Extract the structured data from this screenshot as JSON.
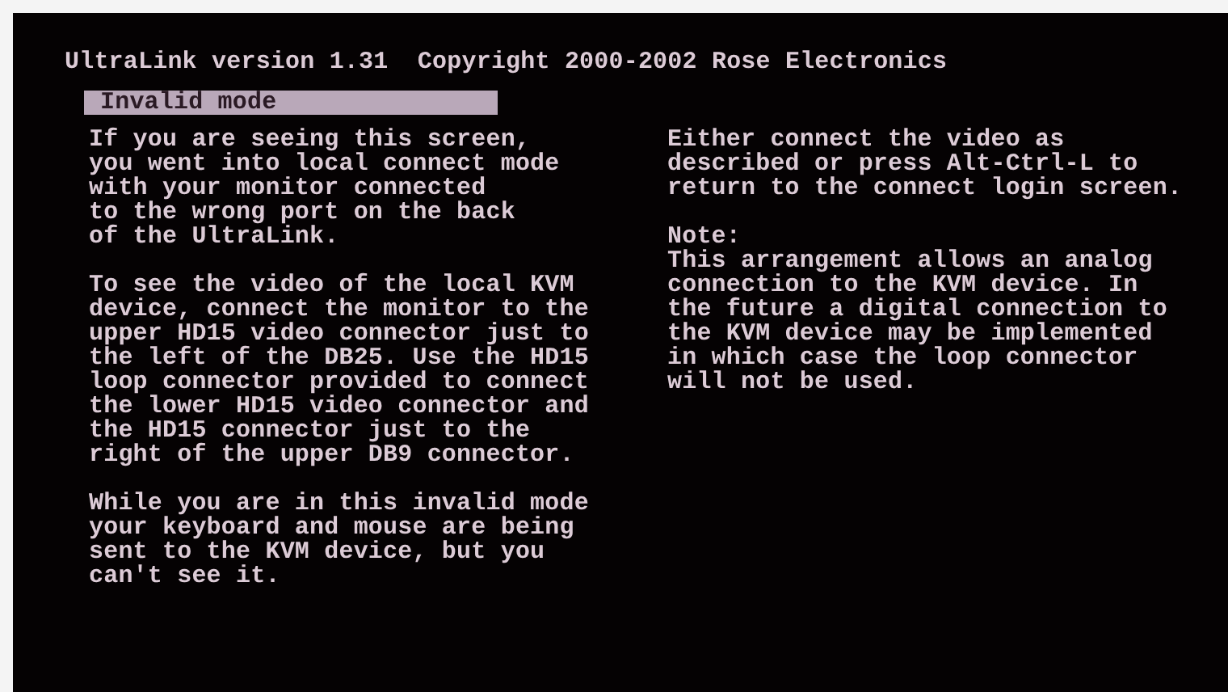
{
  "header": "UltraLink version 1.31  Copyright 2000-2002 Rose Electronics",
  "title_bar": "Invalid mode",
  "left_column": [
    "If you are seeing this screen,\nyou went into local connect mode\nwith your monitor connected\nto the wrong port on the back\nof the UltraLink.",
    "To see the video of the local KVM\ndevice, connect the monitor to the\nupper HD15 video connector just to\nthe left of the DB25. Use the HD15\nloop connector provided to connect\nthe lower HD15 video connector and\nthe HD15 connector just to the\nright of the upper DB9 connector.",
    "While you are in this invalid mode\nyour keyboard and mouse are being\nsent to the KVM device, but you\ncan't see it."
  ],
  "right_column": {
    "instructions": "Either connect the video as\ndescribed or press Alt-Ctrl-L to\nreturn to the connect login screen.",
    "note_label": "Note:",
    "note": "This arrangement allows an analog\nconnection to the KVM device. In\nthe future a digital connection to\nthe KVM device may be implemented\nin which case the loop connector\nwill not be used."
  }
}
